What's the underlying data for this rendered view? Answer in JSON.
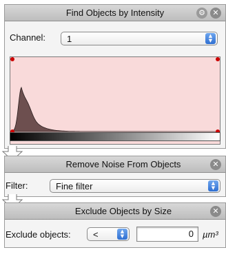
{
  "panel1": {
    "title": "Find Objects by Intensity",
    "channel_label": "Channel:",
    "channel_value": "1",
    "histogram": {
      "fill_color": "#f9dada",
      "curve_color": "#6d4f4f",
      "marker_color": "#cc0000"
    }
  },
  "panel2": {
    "title": "Remove Noise From Objects",
    "filter_label": "Filter:",
    "filter_value": "Fine filter"
  },
  "panel3": {
    "title": "Exclude Objects by Size",
    "exclude_label": "Exclude objects:",
    "operator_value": "<",
    "size_value": "0",
    "unit": "µm³"
  },
  "icons": {
    "close": "close-icon",
    "gear": "gear-icon",
    "popup": "popup-arrows-icon",
    "connector": "down-arrow-connector-icon"
  }
}
